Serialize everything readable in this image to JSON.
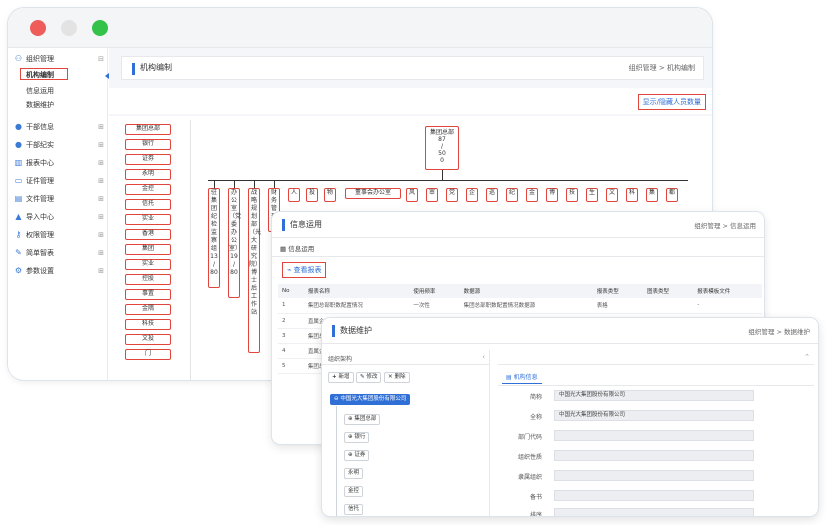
{
  "window1": {
    "colors": {
      "red": "#ee5d5a",
      "yellow": "#e3e3e3",
      "green": "#35c24a",
      "accent": "#2f6fd6",
      "highlight": "#e0463c"
    },
    "sidebar": {
      "items": [
        {
          "label": "组织管理",
          "icon": "sitemap-icon",
          "toggle": "⊟"
        },
        {
          "label": "干部信息",
          "icon": "globe-icon",
          "toggle": "⊞"
        },
        {
          "label": "干部纪实",
          "icon": "globe-icon",
          "toggle": "⊞"
        },
        {
          "label": "报表中心",
          "icon": "bar-chart-icon",
          "toggle": "⊞"
        },
        {
          "label": "证件管理",
          "icon": "card-icon",
          "toggle": "⊞"
        },
        {
          "label": "文件管理",
          "icon": "file-icon",
          "toggle": "⊞"
        },
        {
          "label": "导入中心",
          "icon": "upload-icon",
          "toggle": "⊞"
        },
        {
          "label": "权限管理",
          "icon": "key-icon",
          "toggle": "⊞"
        },
        {
          "label": "简单智表",
          "icon": "wand-icon",
          "toggle": "⊞"
        },
        {
          "label": "参数设置",
          "icon": "gears-icon",
          "toggle": "⊞"
        }
      ],
      "sub_items": [
        "机构编制",
        "信息运用",
        "数据维护"
      ]
    },
    "page_title": "机构编制",
    "breadcrumb": "组织管理 > 机构编制",
    "toggle_button": "显示/隐藏人员数量",
    "root_node": {
      "name": "集团总部",
      "count_lines": [
        "87",
        "/",
        "50",
        "0"
      ]
    },
    "left_column": [
      "集团总部",
      "银行",
      "证券",
      "永明",
      "金控",
      "信托",
      "实业",
      "香港",
      "集团",
      "实业",
      "控股",
      "事置",
      "金隅",
      "科技",
      "文投",
      "门"
    ],
    "top_children": [
      "办公室（党委办公室）",
      "人",
      "投",
      "物",
      "董事会办公室",
      "风",
      "审",
      "党",
      "企",
      "巡",
      "纪",
      "金",
      "博",
      "技",
      "生",
      "文",
      "科",
      "集",
      "都"
    ],
    "vertical_children": [
      {
        "text": "驻集团纪检监察组",
        "sub": "13 / 80"
      },
      {
        "text": "办公室（党委办公室）",
        "sub": "19 / 80"
      },
      {
        "text": "战略规划部（光大研究院）",
        "sub": "博士后工作站"
      },
      {
        "text": "财务管理部",
        "sub": ""
      }
    ]
  },
  "window2": {
    "title": "信息运用",
    "breadcrumb": "组织管理 > 信息运用",
    "subheader": "信息运用",
    "view_button": "查看报表",
    "table": {
      "headers": [
        "No",
        "报表名称",
        "使用频率",
        "数据源",
        "报表类型",
        "图表类型",
        "报表模板文件"
      ],
      "rows": [
        [
          "1",
          "集团总部职数配置情况",
          "一次性",
          "集团总部职数配置情况数据源",
          "表格",
          "",
          "-"
        ],
        [
          "2",
          "直属企业职数配置情况",
          "一次性",
          "直属企业职数配置情况数据源",
          "表格",
          "",
          ""
        ],
        [
          "3",
          "集团总",
          "",
          "",
          "",
          "",
          ""
        ],
        [
          "4",
          "直属企",
          "",
          "",
          "",
          "",
          ""
        ],
        [
          "5",
          "集团总",
          "",
          "",
          "",
          "",
          ""
        ]
      ]
    }
  },
  "window3": {
    "title": "数据维护",
    "breadcrumb": "组织管理 > 数据维护",
    "tree_title": "组织架构",
    "buttons": {
      "add": "新增",
      "edit": "修改",
      "delete": "删除"
    },
    "root": "中国光大集团股份有限公司",
    "tree_nodes": [
      "集团总部",
      "银行",
      "证券",
      "永明",
      "金控",
      "信托"
    ],
    "tab": "机构信息",
    "fields": [
      {
        "label": "简称",
        "value": "中国光大集团股份有限公司"
      },
      {
        "label": "全称",
        "value": "中国光大集团股份有限公司"
      },
      {
        "label": "部门代码",
        "value": ""
      },
      {
        "label": "组织性质",
        "value": ""
      },
      {
        "label": "隶属组织",
        "value": ""
      },
      {
        "label": "备书",
        "value": ""
      },
      {
        "label": "排序",
        "value": ""
      }
    ]
  }
}
